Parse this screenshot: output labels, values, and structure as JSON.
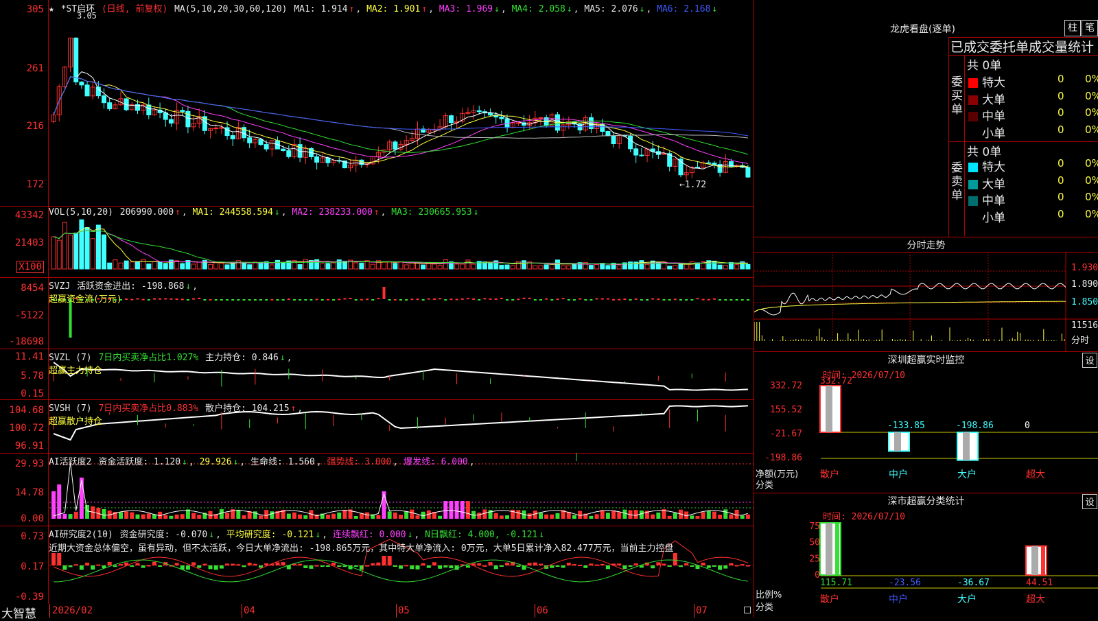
{
  "main": {
    "stock_name": "*ST启环",
    "period": "(日线, 前复权)",
    "ma_label": "MA(5,10,20,30,60,120)",
    "ma1": "MA1: 1.914",
    "ma2": "MA2: 1.901",
    "ma3": "MA3: 1.969",
    "ma4": "MA4: 2.058",
    "ma5": "MA5: 2.076",
    "ma6": "MA6: 2.168",
    "high_marker": "3.05",
    "low_marker": "←1.72",
    "star_marker": "★",
    "y_labels": [
      "305",
      "261",
      "216",
      "172"
    ]
  },
  "vol": {
    "title": "VOL(5,10,20)",
    "value": "206990.000",
    "ma1": "MA1: 244558.594",
    "ma2": "MA2: 238233.000",
    "ma3": "MA3: 230665.953",
    "y_labels": [
      "43342",
      "21403"
    ],
    "unit": "X100"
  },
  "svzj": {
    "title": "SVZJ",
    "line1": "活跃资金进出: -198.868",
    "line2": "超赢资金流(万元)",
    "y_labels": [
      "8454",
      "-5122",
      "-18698"
    ]
  },
  "svzl": {
    "title": "SVZL (7)",
    "ratio": "7日内买卖净占比1.027%",
    "hold": "主力持仓: 0.846",
    "line2": "超赢主力持仓",
    "y_labels": [
      "11.41",
      "5.78",
      "0.15"
    ]
  },
  "svsh": {
    "title": "SVSH (7)",
    "ratio": "7日内买卖净占比0.883%",
    "hold": "散户持仓: 104.215",
    "line2": "超赢散户持仓",
    "y_labels": [
      "104.68",
      "100.72",
      "96.91"
    ]
  },
  "ai1": {
    "title": "AI活跃度2",
    "active": "资金活跃度: 1.120",
    "v2": "29.926",
    "life": "生命线: 1.560",
    "strong": "强势线: 3.000",
    "burst": "爆发线: 6.000",
    "y_labels": [
      "29.93",
      "14.78",
      "0.00"
    ]
  },
  "ai2": {
    "title": "AI研究度2(10)",
    "research": "资金研究度: -0.070",
    "avg": "平均研究度: -0.121",
    "lianxu": "连续飘红: 0.000",
    "nday": "N日飘红: 4.000, -0.121",
    "comment": "近期大资金总体偏空，虽有异动，但不太活跃，今日大单净流出: -198.865万元，其中特大单净流入: 0万元，大单5日累计净入82.477万元，当前主力控盘",
    "y_labels": [
      "0.73",
      "0.17",
      "-0.39"
    ]
  },
  "xaxis": {
    "brand": "大智慧",
    "labels": [
      "2026/02",
      "04",
      "05",
      "06",
      "07"
    ]
  },
  "dragon": {
    "title": "龙虎看盘(逐单)",
    "btn_zhu": "柱",
    "btn_bi": "笔",
    "header": "已成交委托单成交量统计",
    "buy_label": "委买单",
    "sell_label": "委卖单",
    "buy_total": "共 0单",
    "sell_total": "共 0单",
    "buy_rows": [
      {
        "name": "特大",
        "count": "0",
        "pct": "0%",
        "color": "#ff0000"
      },
      {
        "name": "大单",
        "count": "0",
        "pct": "0%",
        "color": "#8b0000"
      },
      {
        "name": "中单",
        "count": "0",
        "pct": "0%",
        "color": "#5a0000"
      },
      {
        "name": "小单",
        "count": "0",
        "pct": "0%",
        "color": ""
      }
    ],
    "sell_rows": [
      {
        "name": "特大",
        "count": "0",
        "pct": "0%",
        "color": "#00e5ff"
      },
      {
        "name": "大单",
        "count": "0",
        "pct": "0%",
        "color": "#009a9a"
      },
      {
        "name": "中单",
        "count": "0",
        "pct": "0%",
        "color": "#006e6e"
      },
      {
        "name": "小单",
        "count": "0",
        "pct": "0%",
        "color": ""
      }
    ]
  },
  "intraday": {
    "title": "分时走势",
    "price_labels": [
      "1.930",
      "1.890",
      "1.850"
    ],
    "vol_label": "11516",
    "fen": "分时"
  },
  "sz_monitor": {
    "title": "深圳超赢实时监控",
    "set": "设",
    "time": "时间: 2026/07/10",
    "y_labels": [
      "332.72",
      "155.52",
      "-21.67",
      "-198.86"
    ],
    "bar_values": [
      "332.72",
      "-133.85",
      "-198.86",
      "0"
    ],
    "categories": [
      "散户",
      "中户",
      "大户",
      "超大"
    ],
    "net_label": "净额(万元)",
    "cat_label": "分类"
  },
  "sz_class": {
    "title": "深市超赢分类统计",
    "set": "设",
    "time": "时间: 2026/07/10",
    "y_labels": [
      "75",
      "50",
      "25",
      "0"
    ],
    "bar_values": [
      "115.71",
      "-23.56",
      "-36.67",
      "44.51"
    ],
    "categories": [
      "散户",
      "中户",
      "大户",
      "超大"
    ],
    "ratio_label": "比例%",
    "cat_label": "分类"
  }
}
